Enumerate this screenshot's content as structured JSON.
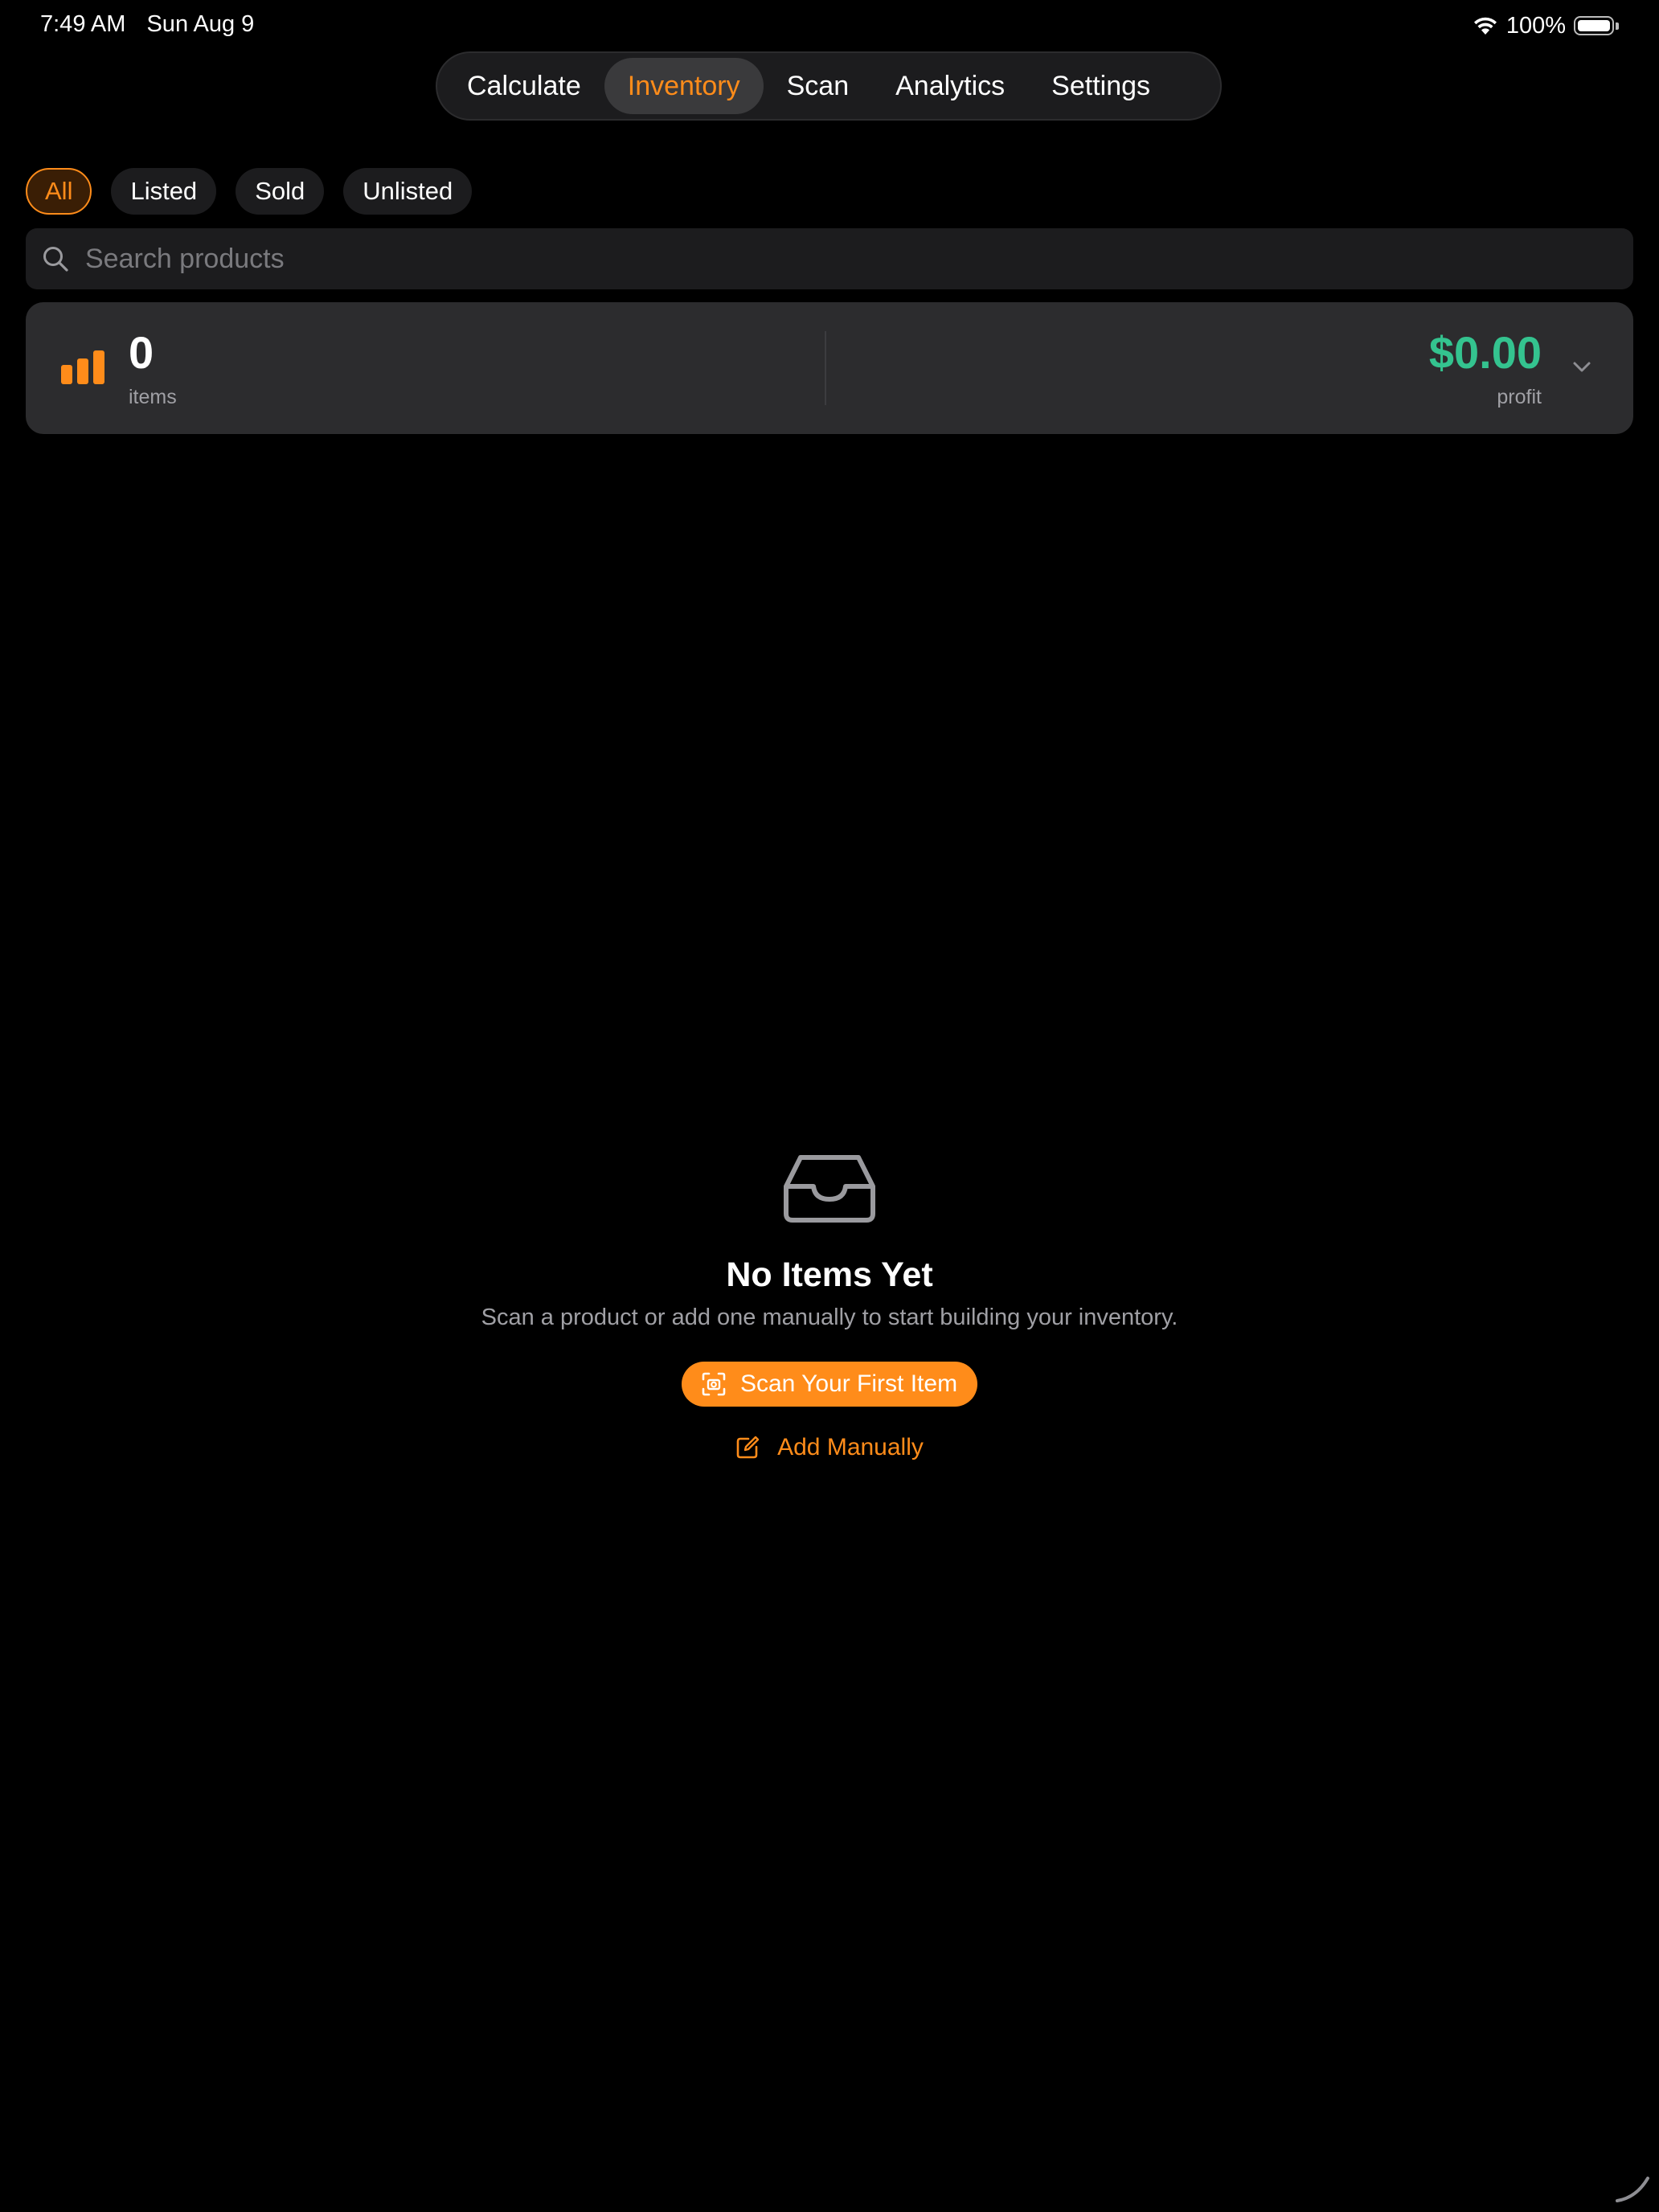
{
  "status_bar": {
    "time": "7:49 AM",
    "date": "Sun Aug 9",
    "battery_percent": "100%",
    "wifi_icon": "wifi-icon",
    "battery_icon": "battery-icon"
  },
  "nav": {
    "tabs": [
      {
        "label": "Calculate",
        "active": false
      },
      {
        "label": "Inventory",
        "active": true
      },
      {
        "label": "Scan",
        "active": false
      },
      {
        "label": "Analytics",
        "active": false
      },
      {
        "label": "Settings",
        "active": false
      }
    ]
  },
  "filters": {
    "chips": [
      {
        "label": "All",
        "active": true
      },
      {
        "label": "Listed",
        "active": false
      },
      {
        "label": "Sold",
        "active": false
      },
      {
        "label": "Unlisted",
        "active": false
      }
    ]
  },
  "search": {
    "placeholder": "Search products",
    "value": "",
    "icon": "search-icon"
  },
  "summary": {
    "count": "0",
    "count_label": "items",
    "profit": "$0.00",
    "profit_label": "profit",
    "chart_icon": "bar-chart-icon",
    "chevron_icon": "chevron-down-icon"
  },
  "empty_state": {
    "icon": "inbox-tray-icon",
    "title": "No Items Yet",
    "subtitle": "Scan a product or add one manually to start building your inventory.",
    "scan_button": "Scan Your First Item",
    "scan_icon": "camera-viewfinder-icon",
    "add_button": "Add Manually",
    "add_icon": "compose-icon"
  },
  "colors": {
    "accent": "#ff8c1a",
    "profit": "#34c38f",
    "background": "#000000",
    "surface": "#1c1c1e",
    "card": "#2c2c2e"
  }
}
